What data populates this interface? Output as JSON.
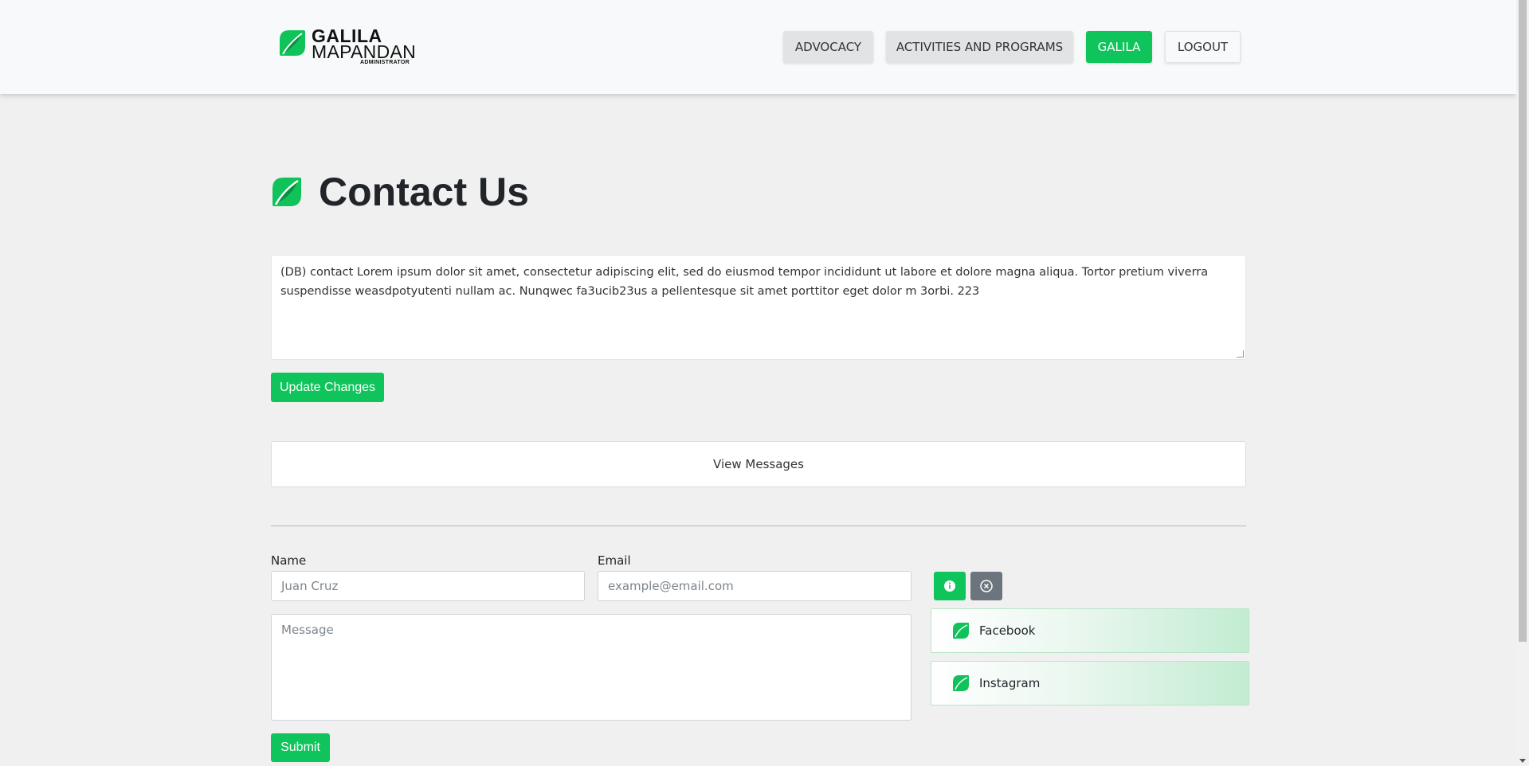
{
  "brand": {
    "line1": "GALILA",
    "line2": "MAPANDAN",
    "line3": "ADMINISTRATOR",
    "accent": "#0fc45a"
  },
  "nav": {
    "advocacy": "ADVOCACY",
    "activities": "ACTIVITIES AND PROGRAMS",
    "galila": "GALILA",
    "logout": "LOGOUT"
  },
  "page": {
    "title": "Contact Us"
  },
  "contact": {
    "description": "(DB) contact  Lorem ipsum dolor sit amet, consectetur adipiscing elit, sed do eiusmod tempor incididunt ut labore et dolore magna aliqua. Tortor pretium viverra suspendisse weasdpotyutenti nullam ac. Nunqwec fa3ucib23us a pellentesque sit amet porttitor eget dolor m 3orbi. 223",
    "update_label": "Update Changes",
    "view_messages_label": "View Messages"
  },
  "form": {
    "name_label": "Name",
    "name_placeholder": "Juan Cruz",
    "email_label": "Email",
    "email_placeholder": "example@email.com",
    "message_placeholder": "Message",
    "submit_label": "Submit"
  },
  "socials": [
    {
      "label": "Facebook",
      "icon": "leaf-icon"
    },
    {
      "label": "Instagram",
      "icon": "leaf-icon"
    }
  ],
  "icons": {
    "info": "info-icon",
    "close": "close-icon"
  }
}
